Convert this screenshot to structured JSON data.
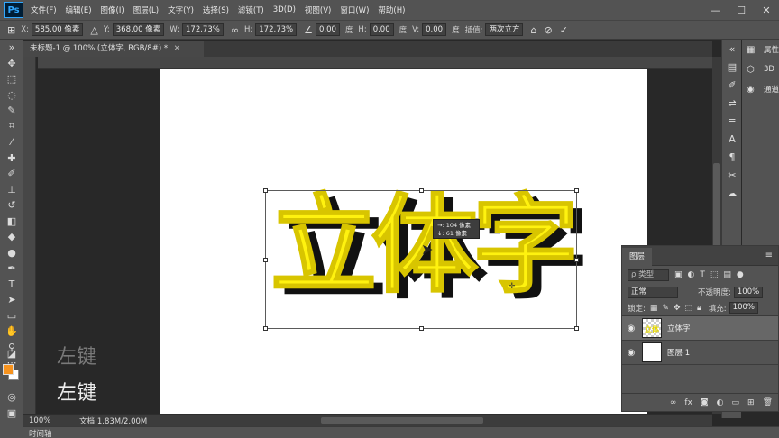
{
  "app": {
    "logo": "Ps"
  },
  "menu": [
    "文件(F)",
    "编辑(E)",
    "图像(I)",
    "图层(L)",
    "文字(Y)",
    "选择(S)",
    "滤镜(T)",
    "3D(D)",
    "视图(V)",
    "窗口(W)",
    "帮助(H)"
  ],
  "window_controls": {
    "minimize": "—",
    "maximize": "☐",
    "close": "✕"
  },
  "options": {
    "x_label": "X:",
    "x_value": "585.00 像素",
    "y_label": "Y:",
    "y_value": "368.00 像素",
    "w_label": "W:",
    "w_value": "172.73%",
    "h_label": "H:",
    "h_value": "172.73%",
    "angle_value": "0.00",
    "angle_unit": "度",
    "hskew_label": "H:",
    "hskew_value": "0.00",
    "hskew_unit": "度",
    "vskew_label": "V:",
    "vskew_value": "0.00",
    "vskew_unit": "度",
    "interp_label": "插值:",
    "interp_value": "两次立方"
  },
  "document": {
    "tab_title": "未标题-1 @ 100% (立体字, RGB/8#) *",
    "tab_close": "✕"
  },
  "canvas_text": [
    "立",
    "体",
    "字"
  ],
  "tooltip": {
    "line1": "→: 104 像素",
    "line2": "↓: 61 像素"
  },
  "status": {
    "zoom": "100%",
    "doc_info": "文档:1.83M/2.00M"
  },
  "timeline": {
    "label": "时间轴"
  },
  "overlay_keys": [
    "左键",
    "左键"
  ],
  "colors": {
    "foreground": "#f7931e",
    "background": "#ffffff",
    "text_face": "#fff20f",
    "text_shadow": "#111111"
  },
  "mini_panels": [
    {
      "icon": "properties-icon",
      "label": "属性"
    },
    {
      "icon": "cube-icon",
      "label": "3D"
    },
    {
      "icon": "channels-icon",
      "label": "通道"
    }
  ],
  "layers_panel": {
    "title": "图层",
    "menu": "≡",
    "filter_placeholder": "ρ 类型",
    "blend_mode": "正常",
    "opacity_label": "不透明度:",
    "opacity_value": "100%",
    "lock_label": "锁定:",
    "fill_label": "填充:",
    "fill_value": "100%",
    "layers": [
      {
        "name": "立体字",
        "selected": true,
        "thumb": "立体"
      },
      {
        "name": "图层 1",
        "selected": false
      }
    ]
  }
}
